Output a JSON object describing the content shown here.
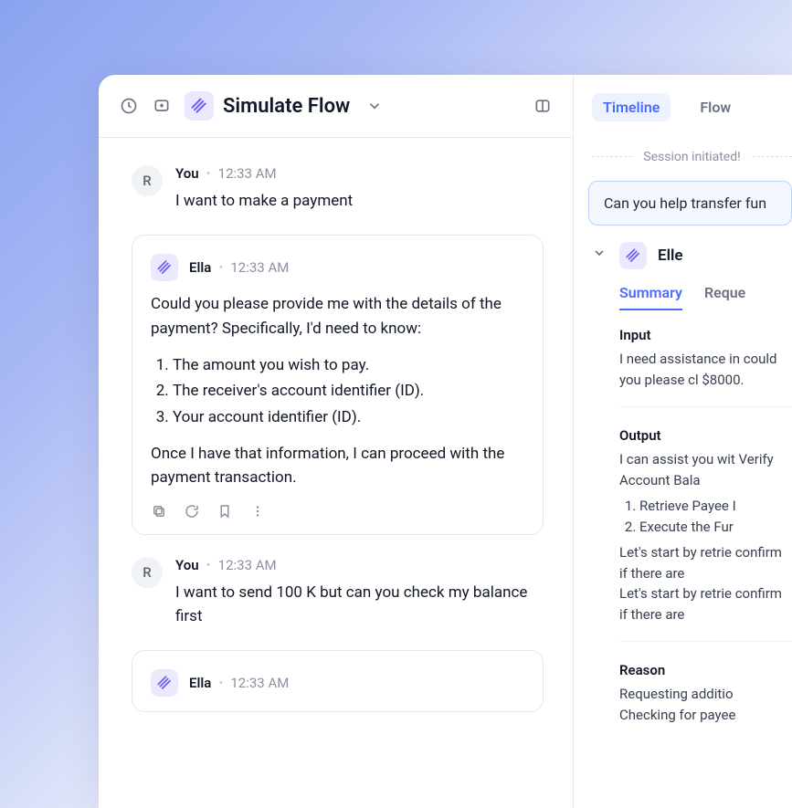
{
  "header": {
    "title": "Simulate Flow"
  },
  "messages": [
    {
      "type": "user",
      "avatar_letter": "R",
      "name": "You",
      "time": "12:33 AM",
      "text": "I want to make a payment"
    },
    {
      "type": "bot",
      "name": "Ella",
      "time": "12:33 AM",
      "intro": "Could you please provide me with the details of the payment? Specifically, I'd need to know:",
      "items": [
        "The amount you wish to pay.",
        "The receiver's account identifier (ID).",
        "Your account identifier (ID)."
      ],
      "outro": "Once I have that information, I can proceed with the payment transaction."
    },
    {
      "type": "user",
      "avatar_letter": "R",
      "name": "You",
      "time": "12:33 AM",
      "text": "I want to send 100 K but can you check my balance first"
    },
    {
      "type": "bot_stub",
      "name": "Ella",
      "time": "12:33 AM"
    }
  ],
  "right": {
    "tabs": {
      "timeline": "Timeline",
      "flow": "Flow"
    },
    "session_label": "Session initiated!",
    "prompt": "Can you help transfer fun",
    "agent_name": "Elle",
    "sub_tabs": {
      "summary": "Summary",
      "request": "Reque"
    },
    "input": {
      "label": "Input",
      "text": "I need assistance in could you please cl $8000."
    },
    "output": {
      "label": "Output",
      "lead": "I can assist you wit Verify Account Bala",
      "items": [
        "Retrieve Payee I",
        "Execute the Fur"
      ],
      "trail1": "Let's start by retrie confirm if there are",
      "trail2": "Let's start by retrie confirm if there are"
    },
    "reason": {
      "label": "Reason",
      "text": "Requesting additio Checking for payee"
    }
  }
}
